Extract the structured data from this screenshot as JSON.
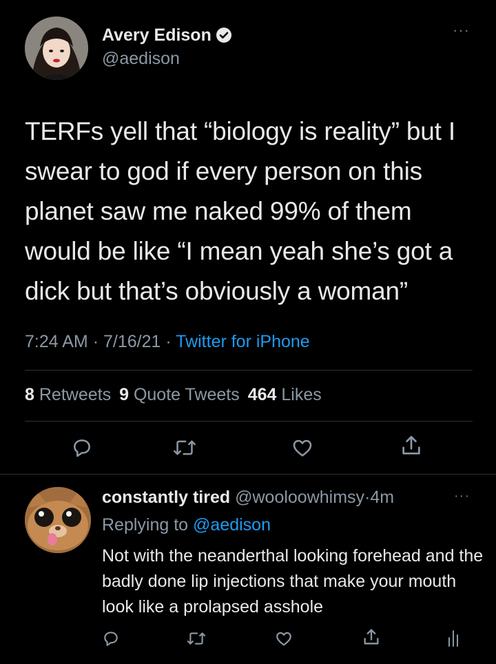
{
  "tweet": {
    "author": {
      "display_name": "Avery Edison",
      "handle": "@aedison",
      "verified": true
    },
    "text": "TERFs yell that “biology is reality” but I swear to god if every person on this planet saw me naked 99% of them would be like “I mean yeah she’s got a dick but that’s obviously a woman”",
    "time": "7:24 AM",
    "date": "7/16/21",
    "separator": "·",
    "source": "Twitter for iPhone",
    "stats": {
      "retweets_count": "8",
      "retweets_label": "Retweets",
      "quotes_count": "9",
      "quotes_label": "Quote Tweets",
      "likes_count": "464",
      "likes_label": "Likes"
    },
    "icons": [
      "reply-icon",
      "retweet-icon",
      "like-icon",
      "share-icon"
    ]
  },
  "reply": {
    "author": {
      "display_name": "constantly tired",
      "handle": "@wooloowhimsy",
      "time": "4m"
    },
    "separator": "·",
    "replying_prefix": "Replying to",
    "replying_to": "@aedison",
    "text": "Not with the neanderthal looking forehead and the badly done lip injections that make your mouth look like a prolapsed asshole",
    "icons": [
      "reply-icon",
      "retweet-icon",
      "like-icon",
      "share-icon",
      "analytics-icon"
    ]
  },
  "colors": {
    "background": "#000000",
    "text_primary": "#e7e9ea",
    "text_secondary": "#8b98a5",
    "accent": "#1d9bf0",
    "divider": "#2f3336"
  }
}
